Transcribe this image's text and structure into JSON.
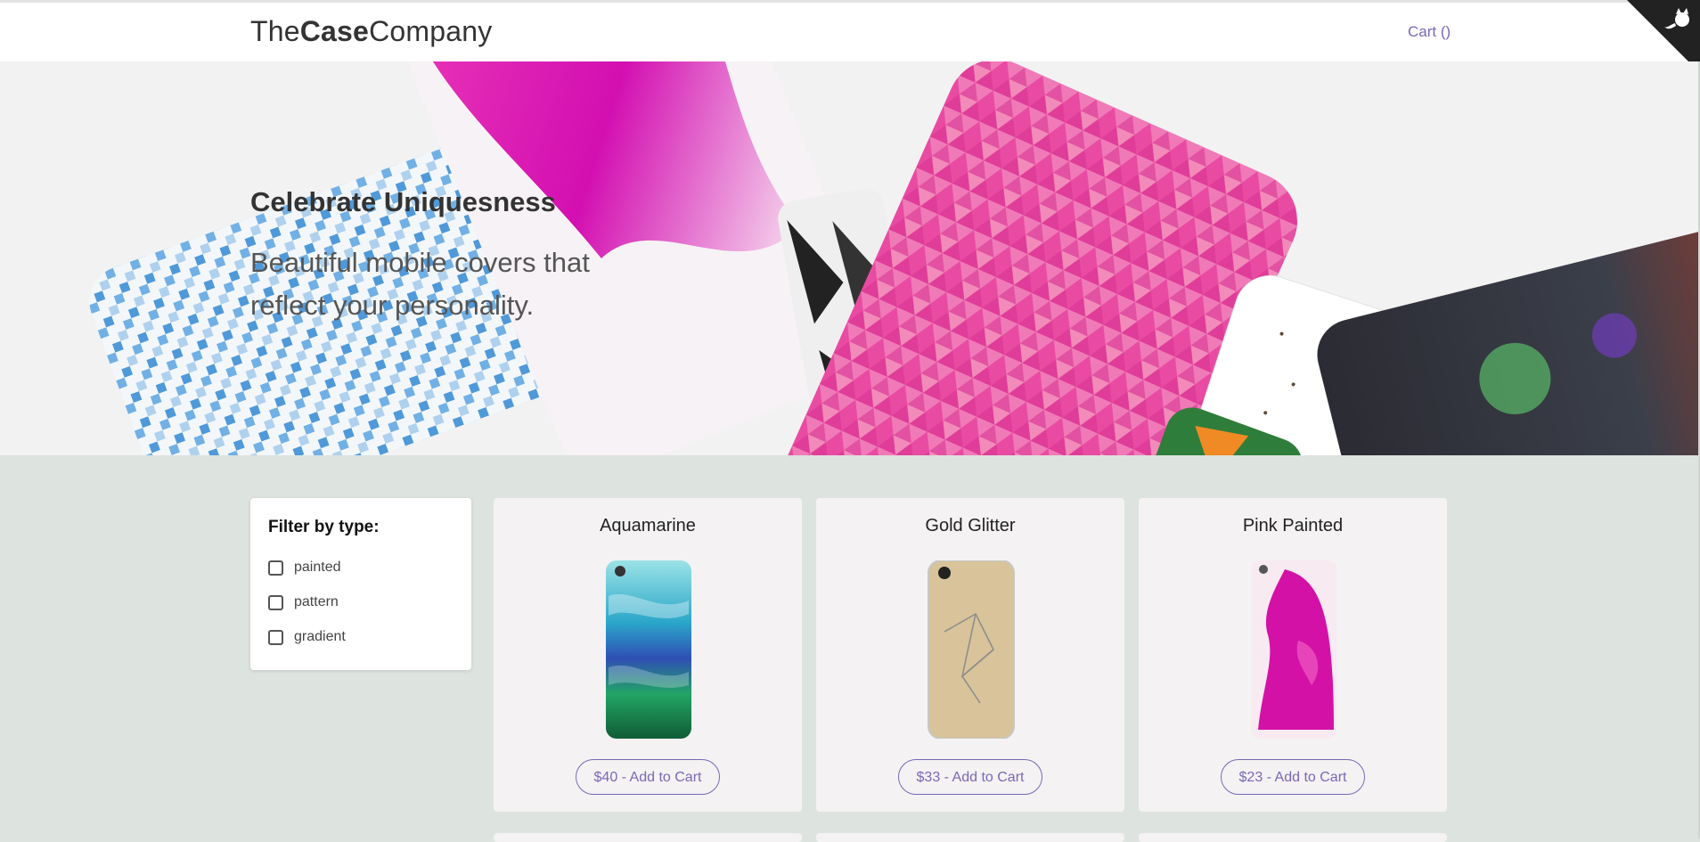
{
  "header": {
    "logo_prefix": "The",
    "logo_bold": "Case",
    "logo_suffix": "Company",
    "cart_label": "Cart ()"
  },
  "hero": {
    "title": "Celebrate Uniquesness",
    "subtitle": "Beautiful mobile covers that reflect your personality."
  },
  "filter": {
    "title": "Filter by type:",
    "options": [
      {
        "label": "painted",
        "checked": false
      },
      {
        "label": "pattern",
        "checked": false
      },
      {
        "label": "gradient",
        "checked": false
      }
    ]
  },
  "products": [
    {
      "name": "Aquamarine",
      "button": "$40 - Add to Cart"
    },
    {
      "name": "Gold Glitter",
      "button": "$33 - Add to Cart"
    },
    {
      "name": "Pink Painted",
      "button": "$23 - Add to Cart"
    }
  ],
  "colors": {
    "accent": "#7b68b5",
    "page_bg": "#dde3de",
    "card_bg": "#f4f2f3",
    "text": "#333333"
  },
  "icons": {
    "corner": "github-corner-icon"
  }
}
